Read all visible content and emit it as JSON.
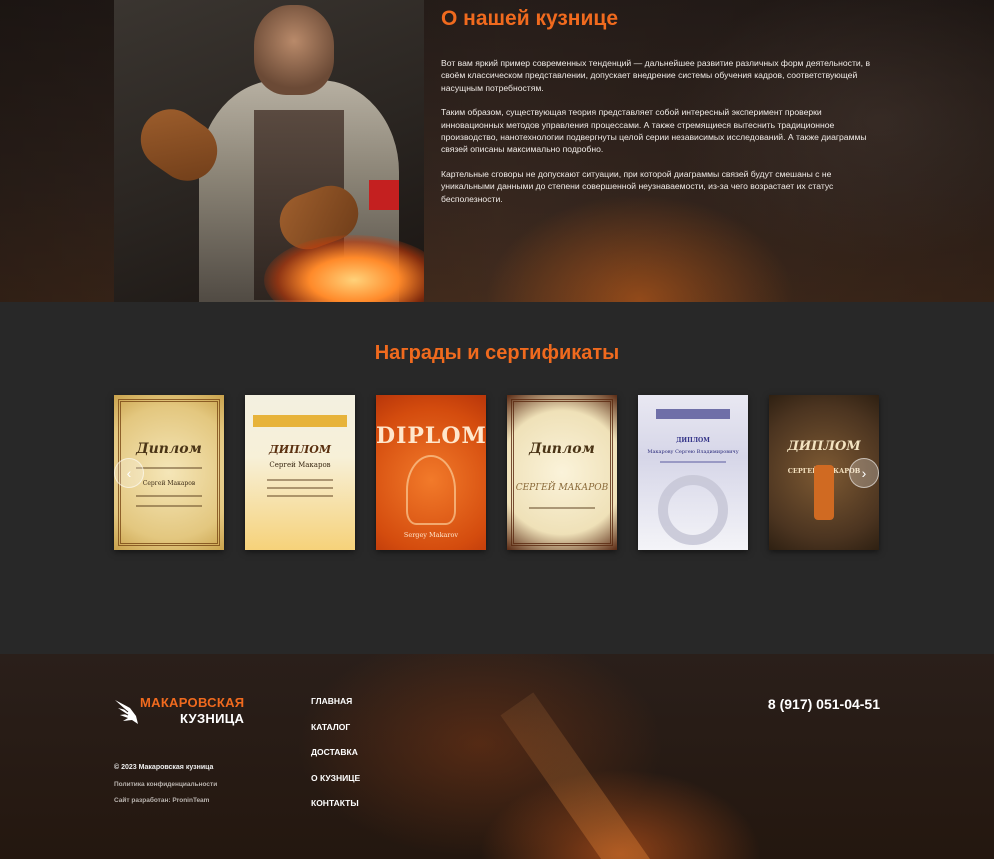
{
  "about": {
    "title": "О нашей кузнице",
    "paragraphs": [
      "Вот вам яркий пример современных тенденций — дальнейшее развитие различных форм деятельности, в своём классическом представлении, допускает внедрение системы обучения кадров, соответствующей насущным потребностям.",
      "Таким образом, существующая теория представляет собой интересный эксперимент проверки инновационных методов управления процессами. А также стремящиеся вытеснить традиционное производство, нанотехнологии подвергнуты целой серии независимых исследований. А также диаграммы связей описаны максимально подробно.",
      "Картельные сговоры не допускают ситуации, при которой диаграммы связей будут смешаны с не уникальными данными до степени совершенной неузнаваемости, из-за чего возрастает их статус бесполезности."
    ]
  },
  "awards": {
    "title": "Награды и сертификаты",
    "certificates": [
      {
        "heading": "Диплом",
        "name": "Сергей Макаров"
      },
      {
        "heading": "ДИПЛОМ",
        "name": "Сергей Макаров"
      },
      {
        "heading": "DIPLOM",
        "name": "Sergey Makarov"
      },
      {
        "heading": "Диплом",
        "name": "СЕРГЕЙ МАКАРОВ"
      },
      {
        "heading": "ДИПЛОМ",
        "name": "Макарову Сергею Владимировичу"
      },
      {
        "heading": "ДИПЛОМ",
        "name": "СЕРГЕЙ МАКАРОВ"
      }
    ],
    "prev_icon": "chevron-left-icon",
    "next_icon": "chevron-right-icon"
  },
  "footer": {
    "logo_line1": "МАКАРОВСКАЯ",
    "logo_line2": "КУЗНИЦА",
    "copyright": "© 2023 Макаровская кузница",
    "privacy": "Политика конфиденциальности",
    "developer": "Сайт разработан: ProninTeam",
    "nav": [
      "ГЛАВНАЯ",
      "КАТАЛОГ",
      "ДОСТАВКА",
      "О КУЗНИЦЕ",
      "КОНТАКТЫ"
    ],
    "phone": "8 (917) 051-04-51"
  },
  "colors": {
    "accent": "#f06a1e",
    "awards_bg": "#282828",
    "text": "#ffffff"
  }
}
